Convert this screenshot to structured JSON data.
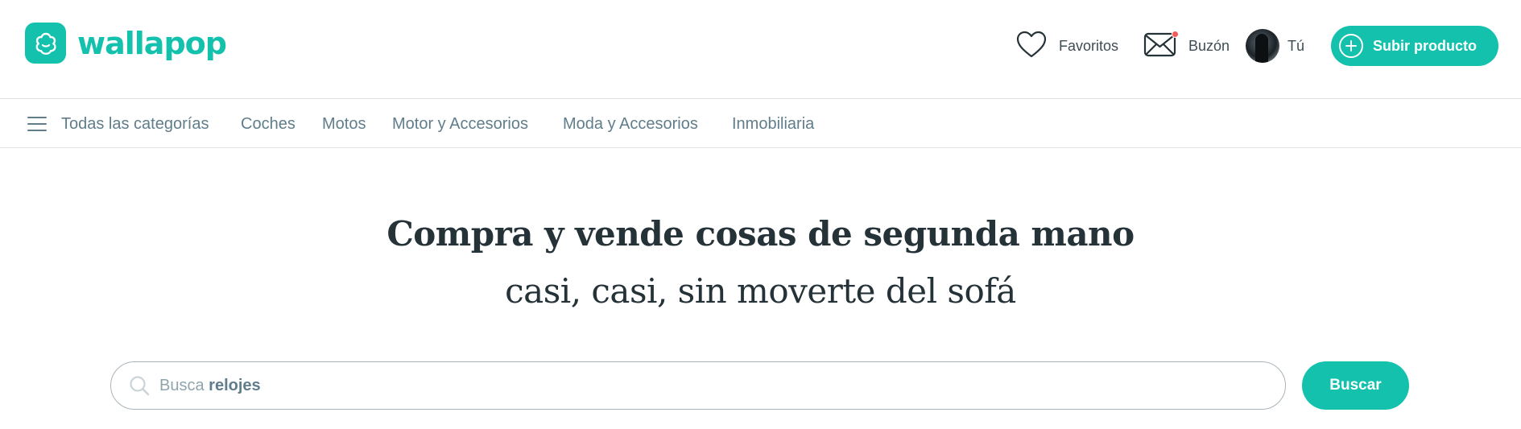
{
  "brand": {
    "name": "wallapop",
    "accent": "#13c1ac"
  },
  "header": {
    "favorites_label": "Favoritos",
    "inbox_label": "Buzón",
    "profile_label": "Tú",
    "upload_label": "Subir producto",
    "inbox_notification_color": "#f45a5a"
  },
  "categories": {
    "menu_icon": "hamburger-icon",
    "items": [
      {
        "label": "Todas las categorías"
      },
      {
        "label": "Coches"
      },
      {
        "label": "Motos"
      },
      {
        "label": "Motor y Accesorios"
      },
      {
        "label": "Moda y Accesorios"
      },
      {
        "label": "Inmobiliaria"
      }
    ]
  },
  "hero": {
    "title": "Compra y vende cosas de segunda mano",
    "subtitle": "casi, casi, sin moverte del sofá"
  },
  "search": {
    "placeholder_prefix": "Busca",
    "placeholder_keyword": "relojes",
    "button_label": "Buscar"
  }
}
